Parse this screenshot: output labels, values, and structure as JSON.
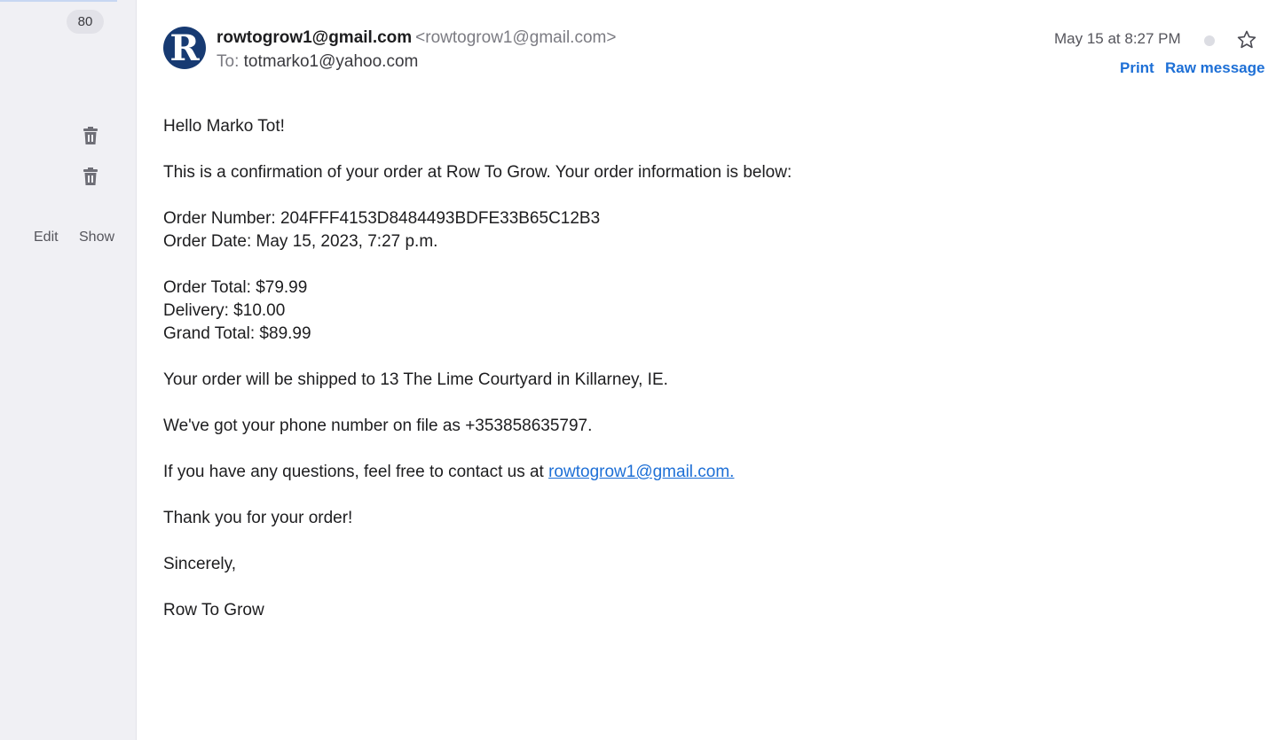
{
  "sidebar": {
    "count": "80",
    "edit_label": "Edit",
    "show_label": "Show"
  },
  "email": {
    "avatar_letter": "R",
    "sender_name": "rowtogrow1@gmail.com",
    "sender_address": "<rowtogrow1@gmail.com>",
    "to_label": "To:",
    "to_address": "totmarko1@yahoo.com",
    "date": "May 15 at 8:27 PM",
    "print_label": "Print",
    "raw_message_label": "Raw message",
    "body": {
      "greeting": "Hello Marko Tot!",
      "intro": "This is a confirmation of your order at Row To Grow. Your order information is below:",
      "order_number": "Order Number: 204FFF4153D8484493BDFE33B65C12B3",
      "order_date": "Order Date: May 15, 2023, 7:27 p.m.",
      "order_total": "Order Total: $79.99",
      "delivery": "Delivery: $10.00",
      "grand_total": "Grand Total: $89.99",
      "shipping": "Your order will be shipped to 13 The Lime Courtyard in Killarney, IE.",
      "phone": "We've got your phone number on file as +353858635797.",
      "questions_prefix": "If you have any questions, feel free to contact us at ",
      "contact_link": "rowtogrow1@gmail.com.",
      "thanks": "Thank you for your order!",
      "sign_off": "Sincerely,",
      "signature": "Row To Grow"
    }
  },
  "colors": {
    "accent": "#1d6fd6",
    "avatar_bg": "#173a72",
    "sidebar_bg": "#f0f0f4"
  },
  "icons": [
    "trash-icon",
    "trash-icon",
    "unread-dot-icon",
    "star-icon"
  ]
}
